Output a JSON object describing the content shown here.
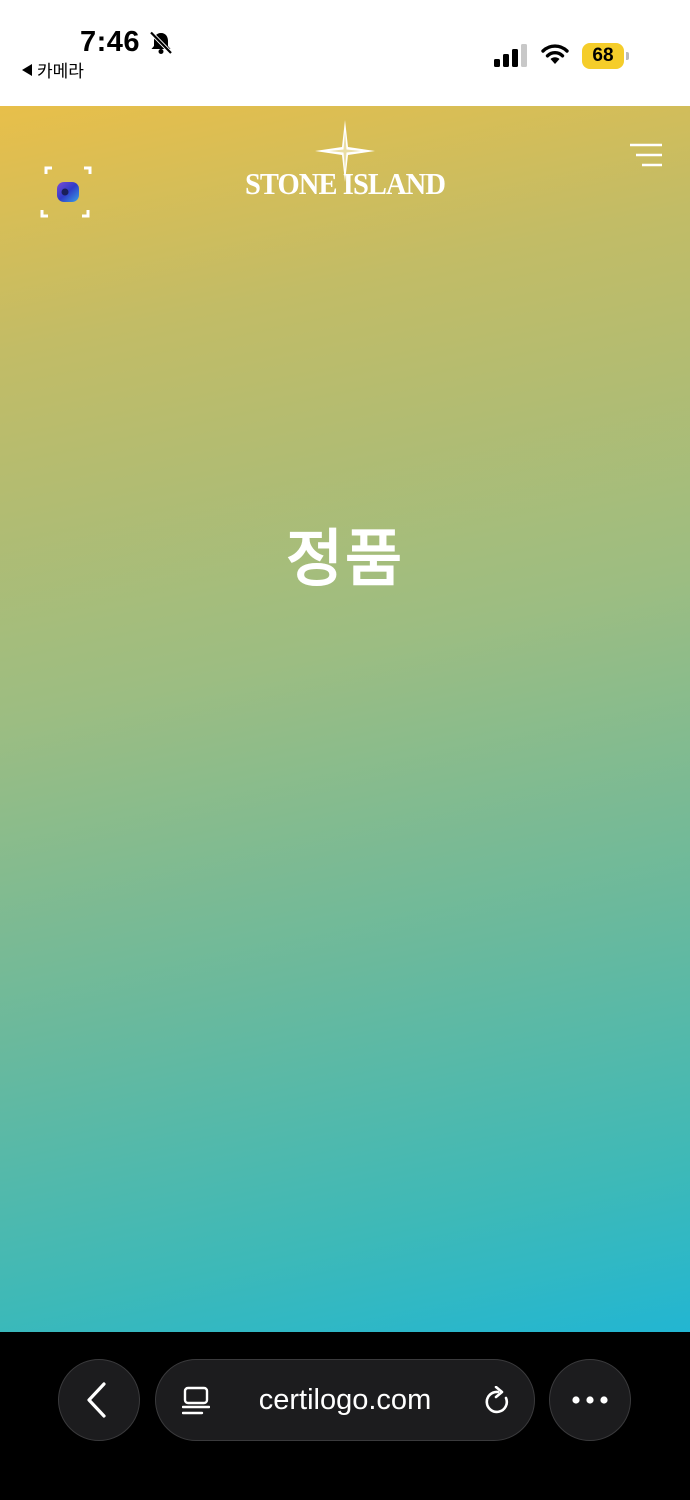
{
  "status_bar": {
    "time": "7:46",
    "back_app_label": "카메라",
    "battery_level": "68",
    "battery_color": "#f5cd2a",
    "icons": [
      "bell-slash-icon",
      "signal-icon",
      "wifi-icon",
      "battery-icon"
    ]
  },
  "header": {
    "logo_text": "STONE ISLAND",
    "scan_icon": "scan-icon",
    "menu_icon": "menu-icon"
  },
  "main": {
    "result_text": "정품",
    "gradient_colors": [
      "#e8bf4a",
      "#9cbd82",
      "#22b6d2"
    ]
  },
  "browser": {
    "url": "certilogo.com",
    "icons": [
      "back-chevron-icon",
      "tabs-icon",
      "reload-icon",
      "more-icon"
    ]
  }
}
